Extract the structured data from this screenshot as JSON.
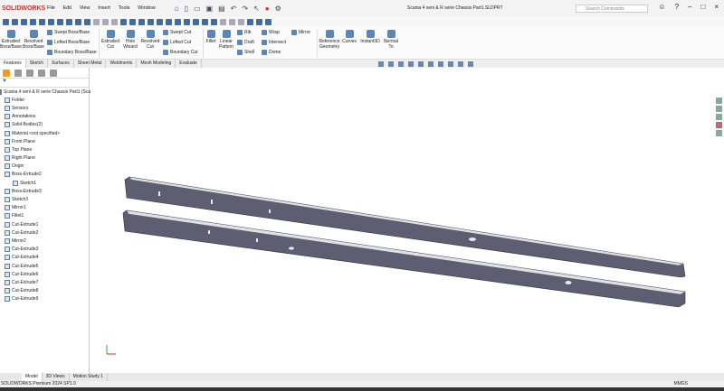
{
  "app": {
    "logo": "SOLIDWORKS",
    "title": "Scania 4 seni & R serie Chassis Part1.SLDPRT",
    "search_placeholder": "Search Commands"
  },
  "menu": [
    "File",
    "Edit",
    "View",
    "Insert",
    "Tools",
    "Window"
  ],
  "commands": {
    "extruded_boss": "Extruded Boss/Base",
    "revolved_boss": "Revolved Boss/Base",
    "swept_boss": "Swept Boss/Base",
    "lofted_boss": "Lofted Boss/Base",
    "boundary_boss": "Boundary Boss/Base",
    "extruded_cut": "Extruded Cut",
    "hole_wizard": "Hole Wizard",
    "revolved_cut": "Revolved Cut",
    "swept_cut": "Swept Cut",
    "lofted_cut": "Lofted Cut",
    "boundary_cut": "Boundary Cut",
    "fillet": "Fillet",
    "linear_pattern": "Linear Pattern",
    "rib": "Rib",
    "draft": "Draft",
    "shell": "Shell",
    "wrap": "Wrap",
    "intersect": "Intersect",
    "dome": "Dome",
    "mirror": "Mirror",
    "reference_geometry": "Reference Geometry",
    "curves": "Curves",
    "instant3d": "Instant3D",
    "normal_to": "Normal To"
  },
  "tabs": [
    "Features",
    "Sketch",
    "Surfaces",
    "Sheet Metal",
    "Weldments",
    "Mesh Modeling",
    "Evaluate"
  ],
  "tree": [
    "Scania 4 seni & R serie Chassis Part1 (Sca",
    "Folder",
    "Sensors",
    "Annotations",
    "Solid Bodies(2)",
    "Material <not specified>",
    "Front Plane",
    "Top Plane",
    "Right Plane",
    "Origin",
    "Boss-Extrude2",
    "Sketch1",
    "Boss-Extrude3",
    "Sketch3",
    "Mirror1",
    "Fillet1",
    "Cut-Extrude1",
    "Cut-Extrude2",
    "Mirror2",
    "Cut-Extrude3",
    "Cut-Extrude4",
    "Cut-Extrude5",
    "Cut-Extrude6",
    "Cut-Extrude7",
    "Cut-Extrude8",
    "Cut-Extrude9"
  ],
  "bottom_tabs": [
    "Model",
    "3D Views",
    "Motion Study 1"
  ],
  "status": {
    "product": "SOLIDWORKS Premium 2024 SP1.0",
    "units": "MMGS"
  }
}
